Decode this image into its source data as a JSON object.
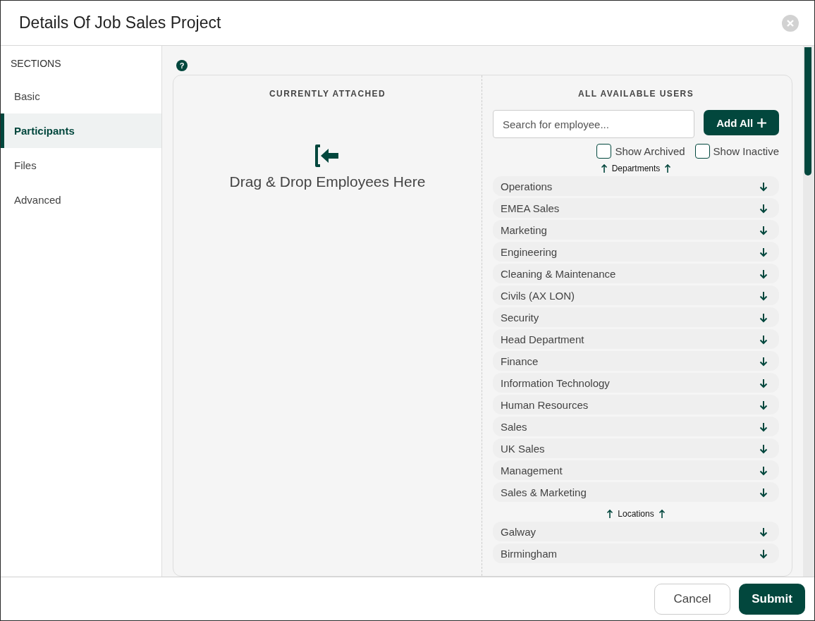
{
  "dialog": {
    "title": "Details Of Job Sales Project"
  },
  "sidebar": {
    "heading": "SECTIONS",
    "items": [
      {
        "label": "Basic",
        "selected": false
      },
      {
        "label": "Participants",
        "selected": true
      },
      {
        "label": "Files",
        "selected": false
      },
      {
        "label": "Advanced",
        "selected": false
      }
    ]
  },
  "help": {
    "icon_text": "?"
  },
  "attached": {
    "heading": "CURRENTLY ATTACHED",
    "drop_text": "Drag & Drop Employees Here"
  },
  "available": {
    "heading": "ALL AVAILABLE USERS",
    "search": {
      "placeholder": "Search for employee..."
    },
    "add_all": "Add All",
    "filters": [
      {
        "label": "Show Archived",
        "checked": false
      },
      {
        "label": "Show Inactive",
        "checked": false
      }
    ],
    "groups": [
      {
        "title": "Departments",
        "items": [
          "Operations",
          "EMEA Sales",
          "Marketing",
          "Engineering",
          "Cleaning & Maintenance",
          "Civils (AX LON)",
          "Security",
          "Head Department",
          "Finance",
          "Information Technology",
          "Human Resources",
          "Sales",
          "UK Sales",
          "Management",
          "Sales & Marketing"
        ]
      },
      {
        "title": "Locations",
        "items": [
          "Galway",
          "Birmingham"
        ]
      }
    ]
  },
  "footer": {
    "buttons": [
      {
        "label": "Cancel",
        "kind": "secondary"
      },
      {
        "label": "Submit",
        "kind": "primary"
      }
    ]
  }
}
